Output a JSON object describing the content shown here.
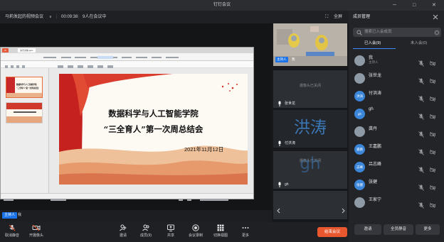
{
  "window": {
    "title": "钉钉会议",
    "fullscreen": "全屏"
  },
  "meeting": {
    "name": "马莉发起的视频会议",
    "timer": "00:09:38",
    "participants": "9人在会议中"
  },
  "ppt": {
    "doc_tab": "演示文稿.pptx",
    "slide_title_line1": "数据科学与人工智能学院",
    "slide_title_line2": "“三全育人”第一次周总结会",
    "slide_date": "2021年11月12日",
    "thumb1_line1": "数据科学与人工智能学院",
    "thumb1_line2": "“三全育人”第一次周总结会"
  },
  "share": {
    "host_tag": "主持人",
    "host_name": "我"
  },
  "thumbs": [
    {
      "host_tag": "主持人",
      "name": "我",
      "type": "video"
    },
    {
      "status": "摄像头已关闭",
      "name": "张世龙"
    },
    {
      "big": "洪涛",
      "name": "付洪涛"
    },
    {
      "status": "摄像头已关闭",
      "big": "gh",
      "name": "gh"
    }
  ],
  "sidebar": {
    "title": "成员管理",
    "search_placeholder": "搜索已入会成员",
    "tabs": [
      "已入会(9)",
      "未入会(0)"
    ],
    "members": [
      {
        "avatar": "",
        "name": "我",
        "sub": "主持人",
        "photo": true
      },
      {
        "avatar": "",
        "name": "张世龙",
        "sub": "",
        "photo": true
      },
      {
        "avatar": "洪涛",
        "name": "付洪涛",
        "sub": ""
      },
      {
        "avatar": "gh",
        "name": "gh",
        "sub": ""
      },
      {
        "avatar": "",
        "name": "龚丹",
        "sub": "",
        "photo": true
      },
      {
        "avatar": "嘉鹏",
        "name": "王嘉鹏",
        "sub": ""
      },
      {
        "avatar": "志峰",
        "name": "吕志峰",
        "sub": ""
      },
      {
        "avatar": "张健",
        "name": "张健",
        "sub": ""
      },
      {
        "avatar": "",
        "name": "王家宁",
        "sub": "",
        "photo": true
      }
    ],
    "buttons": {
      "invite": "邀请",
      "mute_all": "全员静音",
      "more": "更多"
    }
  },
  "toolbar": {
    "mute": "取消静音",
    "camera": "开摄像头",
    "invite": "邀请",
    "members": "成员(9)",
    "share": "共享",
    "record": "会议录制",
    "layout": "切换视图",
    "more": "更多",
    "end": "结束会议"
  },
  "colors": {
    "accent": "#1a73e8",
    "end": "#e8572e"
  }
}
